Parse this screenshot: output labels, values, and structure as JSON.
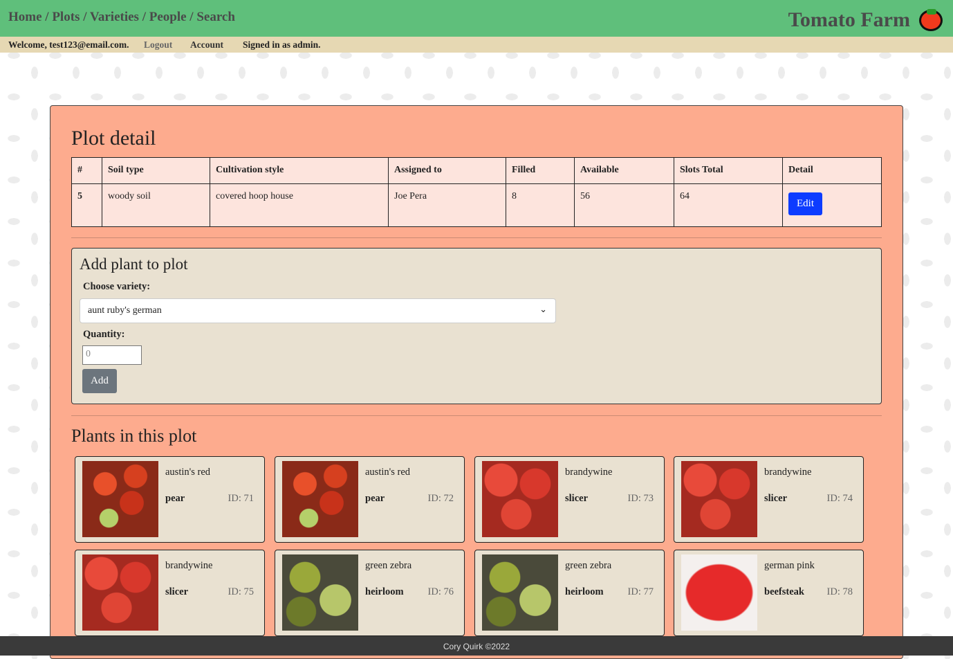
{
  "nav": {
    "items": [
      "Home",
      "Plots",
      "Varieties",
      "People",
      "Search"
    ],
    "brand": "Tomato Farm"
  },
  "subbar": {
    "welcome": "Welcome, test123@email.com.",
    "logout": "Logout",
    "account": "Account",
    "signed": "Signed in as admin."
  },
  "plot": {
    "title": "Plot detail",
    "headers": [
      "#",
      "Soil type",
      "Cultivation style",
      "Assigned to",
      "Filled",
      "Available",
      "Slots Total",
      "Detail"
    ],
    "row": [
      "5",
      "woody soil",
      "covered hoop house",
      "Joe Pera",
      "8",
      "56",
      "64"
    ],
    "edit": "Edit"
  },
  "add": {
    "title": "Add plant to plot",
    "variety_label": "Choose variety:",
    "variety": "aunt ruby's german",
    "qty_label": "Quantity:",
    "qty_placeholder": "0",
    "button": "Add"
  },
  "plants": {
    "title": "Plants in this plot",
    "items": [
      {
        "name": "austin's red",
        "type": "pear",
        "id": "ID: 71",
        "img": "pear"
      },
      {
        "name": "austin's red",
        "type": "pear",
        "id": "ID: 72",
        "img": "pear"
      },
      {
        "name": "brandywine",
        "type": "slicer",
        "id": "ID: 73",
        "img": "red"
      },
      {
        "name": "brandywine",
        "type": "slicer",
        "id": "ID: 74",
        "img": "red"
      },
      {
        "name": "brandywine",
        "type": "slicer",
        "id": "ID: 75",
        "img": "red"
      },
      {
        "name": "green zebra",
        "type": "heirloom",
        "id": "ID: 76",
        "img": "green"
      },
      {
        "name": "green zebra",
        "type": "heirloom",
        "id": "ID: 77",
        "img": "green"
      },
      {
        "name": "german pink",
        "type": "beefsteak",
        "id": "ID: 78",
        "img": "pink"
      }
    ]
  },
  "footer": "Cory Quirk ©2022"
}
